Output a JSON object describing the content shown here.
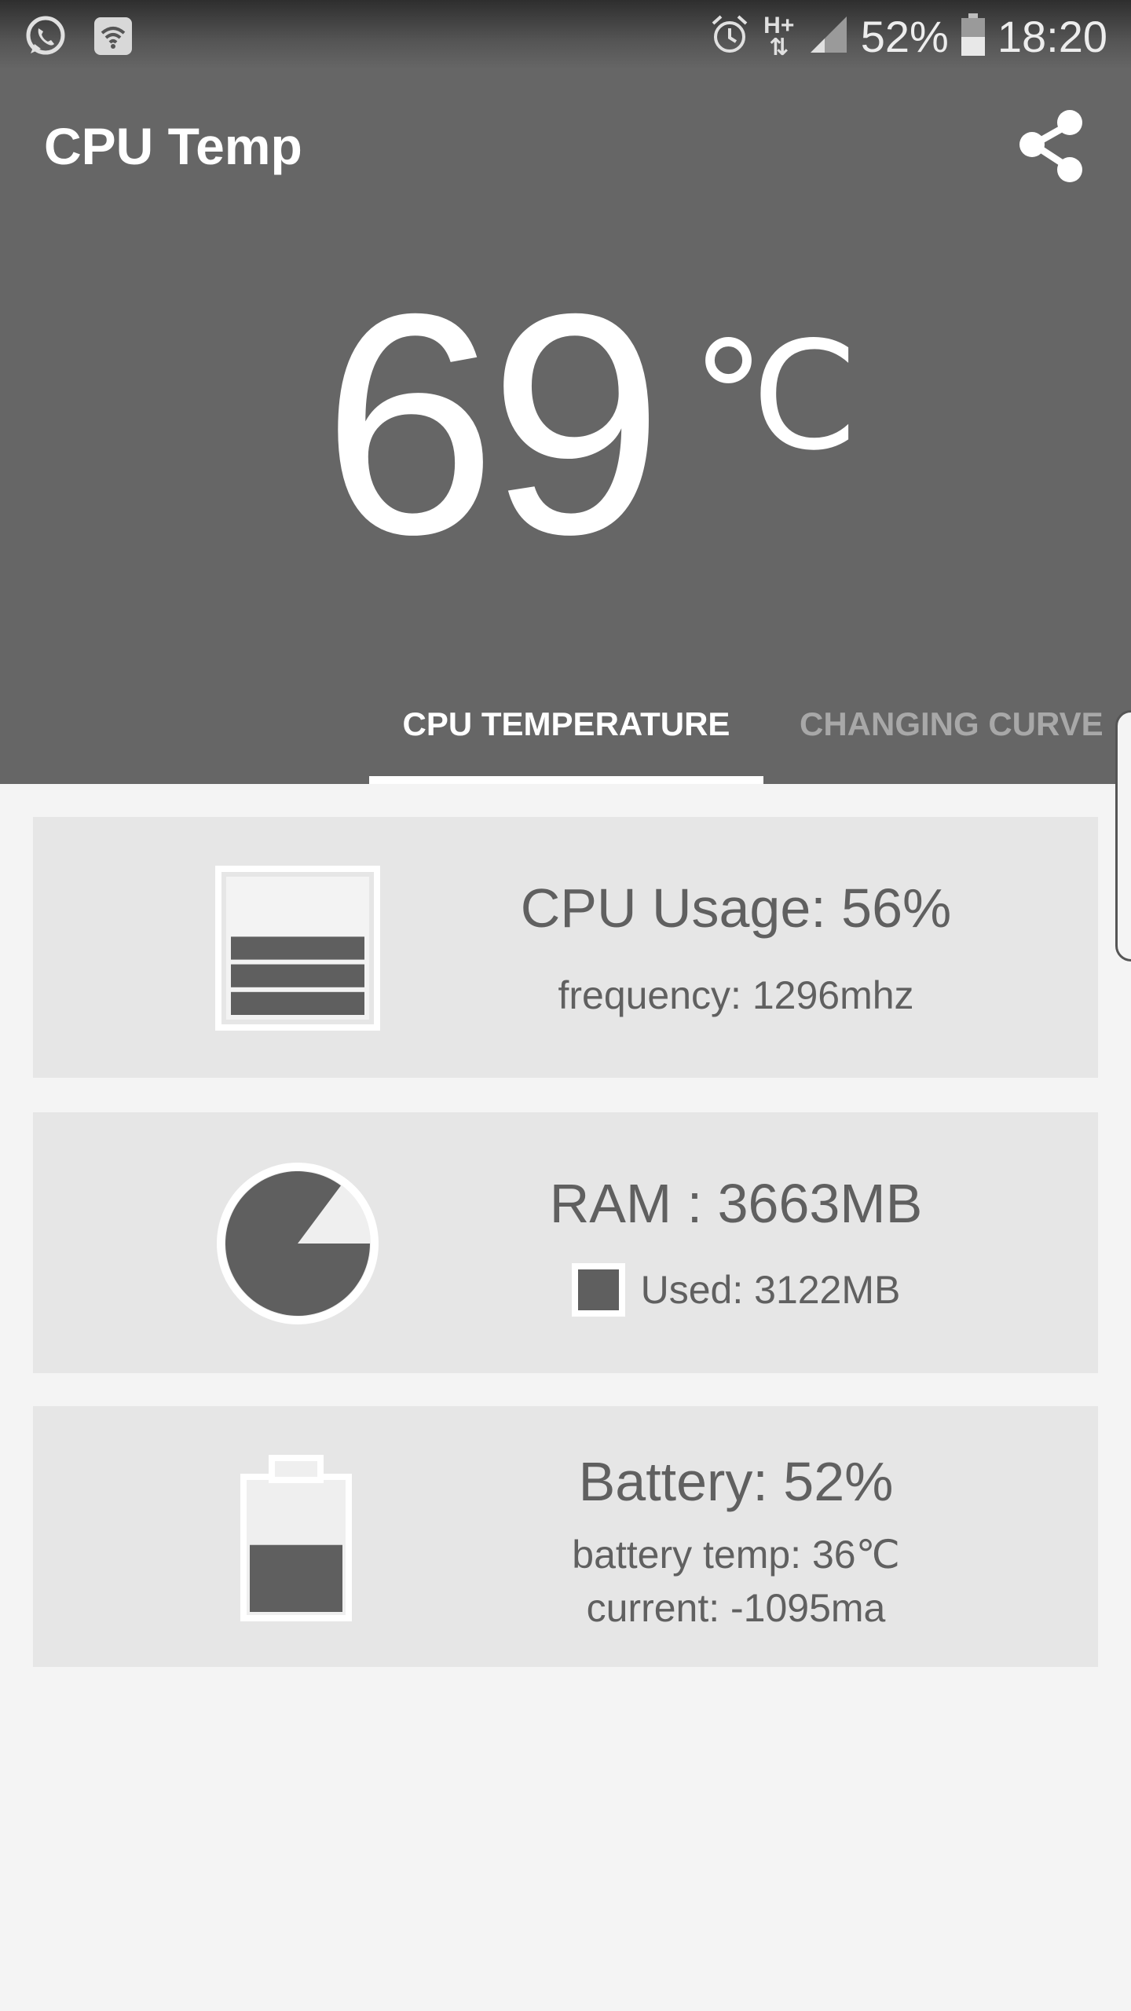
{
  "status_bar": {
    "left_icons": [
      "whatsapp-icon",
      "notification-wifi-icon"
    ],
    "right_icons": [
      "alarm-icon",
      "hplus-data-icon",
      "signal-icon",
      "battery-icon"
    ],
    "network_label": "H+",
    "battery_percent": "52%",
    "time": "18:20"
  },
  "app_bar": {
    "title": "CPU Temp",
    "share_icon": "share-icon"
  },
  "temperature": {
    "value": "69",
    "unit": "℃"
  },
  "tabs": [
    {
      "label": "CPU TEMPERATURE",
      "active": true
    },
    {
      "label": "CHANGING CURVE",
      "active": false
    }
  ],
  "cards": {
    "cpu": {
      "title": "CPU Usage: 56%",
      "sub": "frequency: 1296mhz",
      "icon": "cpu-usage-icon",
      "usage_fraction": 0.56
    },
    "ram": {
      "title": "RAM : 3663MB",
      "used": "Used: 3122MB",
      "icon": "ram-pie-icon",
      "used_fraction": 0.852
    },
    "battery": {
      "title": "Battery: 52%",
      "temp": "battery temp: 36℃",
      "current": "current: -1095ma",
      "icon": "battery-level-icon",
      "level_fraction": 0.52
    }
  },
  "colors": {
    "header_bg": "#666666",
    "card_bg": "#e6e6e6",
    "page_bg": "#f4f4f4",
    "text_dark": "#606060",
    "fill_dark": "#5f5f5f"
  }
}
